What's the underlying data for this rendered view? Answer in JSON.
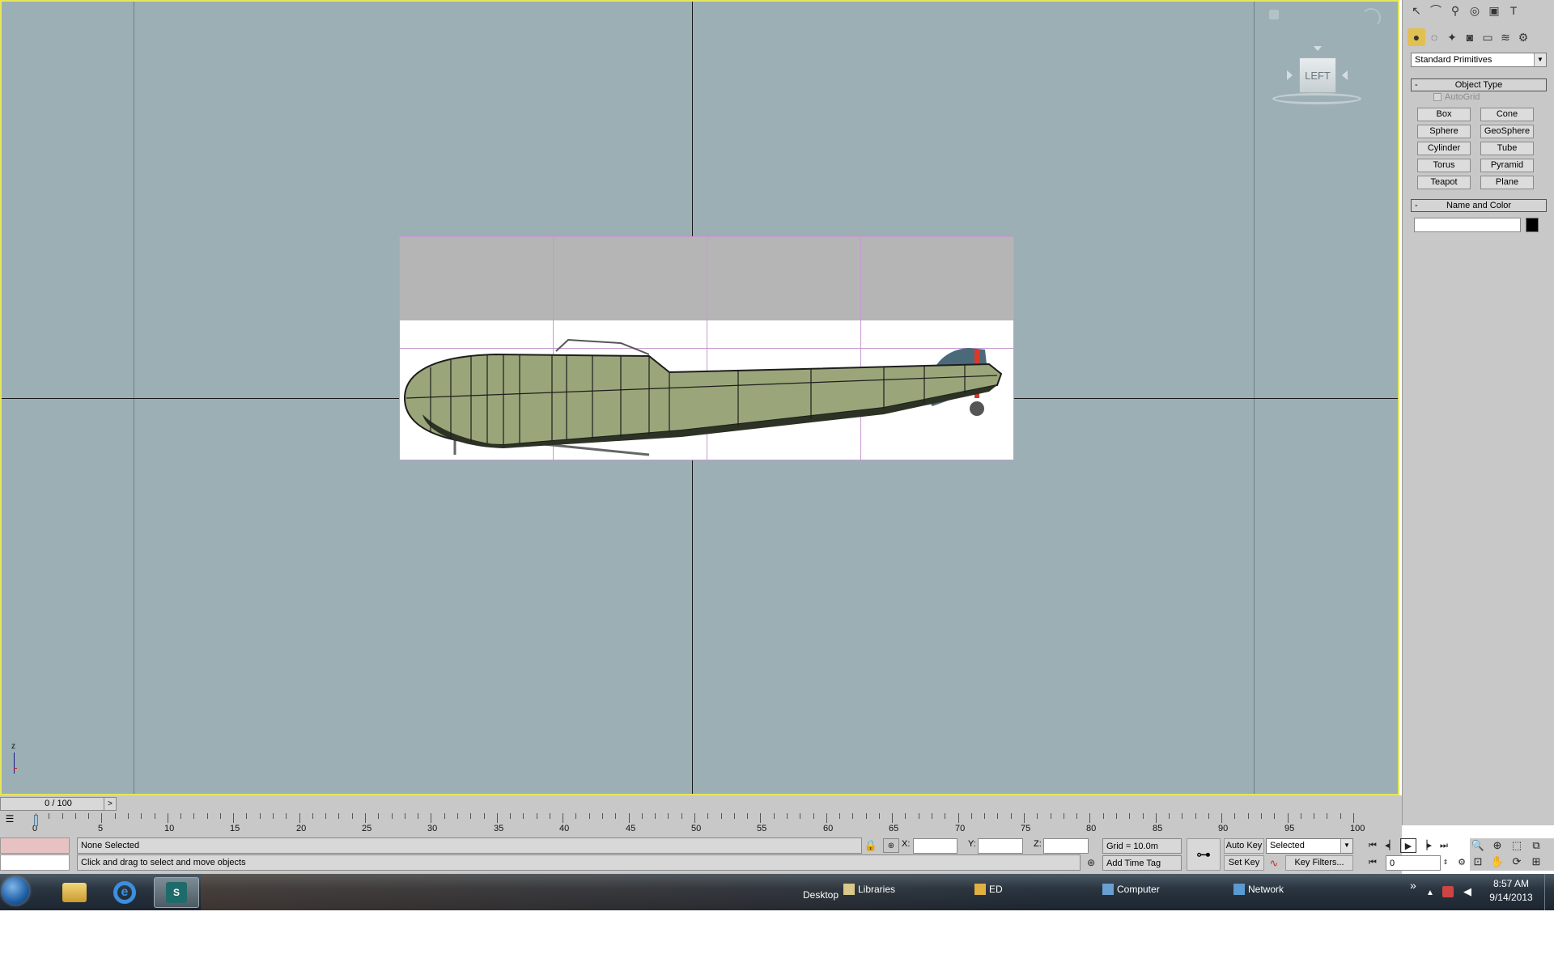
{
  "viewport": {
    "view_label": "LEFT",
    "axis_label": "z"
  },
  "command_panel": {
    "category_dropdown": "Standard Primitives",
    "object_type": {
      "title": "Object Type",
      "collapse": "-",
      "autogrid": "AutoGrid",
      "buttons": [
        "Box",
        "Cone",
        "Sphere",
        "GeoSphere",
        "Cylinder",
        "Tube",
        "Torus",
        "Pyramid",
        "Teapot",
        "Plane"
      ]
    },
    "name_and_color": {
      "title": "Name and Color",
      "collapse": "-",
      "name_value": "",
      "swatch_color": "#000000"
    }
  },
  "timeline": {
    "frame_counter": "0 / 100",
    "ticks": [
      "0",
      "5",
      "10",
      "15",
      "20",
      "25",
      "30",
      "35",
      "40",
      "45",
      "50",
      "55",
      "60",
      "65",
      "70",
      "75",
      "80",
      "85",
      "90",
      "95",
      "100"
    ]
  },
  "status": {
    "selection": "None Selected",
    "prompt": "Click and drag to select and move objects",
    "x_label": "X:",
    "y_label": "Y:",
    "z_label": "Z:",
    "x_value": "",
    "y_value": "",
    "z_value": "",
    "grid": "Grid = 10.0m",
    "add_time_tag": "Add Time Tag"
  },
  "anim": {
    "auto_key": "Auto Key",
    "set_key": "Set Key",
    "selected_dropdown": "Selected",
    "key_filters": "Key Filters...",
    "frame_value": "0"
  },
  "taskbar": {
    "desktop": "Desktop",
    "libraries": "Libraries",
    "ed": "ED",
    "computer": "Computer",
    "network": "Network",
    "overflow": "»",
    "time": "8:57 AM",
    "date": "9/14/2013"
  },
  "colors": {
    "viewport_bg": "#9cafb5",
    "active_border": "#e6e65a",
    "fuselage": "#9aa67a",
    "panel_bg": "#c8c8c8"
  }
}
